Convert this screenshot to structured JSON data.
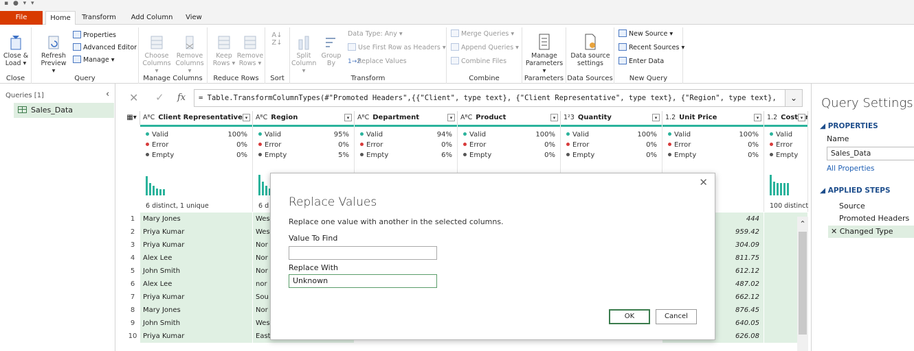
{
  "tabs": {
    "file": "File",
    "items": [
      "Home",
      "Transform",
      "Add Column",
      "View"
    ],
    "active": "Home"
  },
  "ribbon": {
    "close_group": "Close",
    "close_load": "Close &",
    "close_load2": "Load ▾",
    "query_group": "Query",
    "refresh": "Refresh",
    "refresh2": "Preview ▾",
    "properties": "Properties",
    "advanced_editor": "Advanced Editor",
    "manage": "Manage ▾",
    "manage_columns_group": "Manage Columns",
    "choose_columns": "Choose",
    "choose_columns2": "Columns ▾",
    "remove_columns": "Remove",
    "remove_columns2": "Columns ▾",
    "reduce_rows_group": "Reduce Rows",
    "keep_rows": "Keep",
    "keep_rows2": "Rows ▾",
    "remove_rows": "Remove",
    "remove_rows2": "Rows ▾",
    "sort_group": "Sort",
    "transform_group": "Transform",
    "split_column": "Split",
    "split_column2": "Column ▾",
    "group_by": "Group",
    "group_by2": "By",
    "data_type": "Data Type: Any ▾",
    "use_first_row": "Use First Row as Headers ▾",
    "replace_values": "Replace Values",
    "combine_group": "Combine",
    "merge_queries": "Merge Queries ▾",
    "append_queries": "Append Queries ▾",
    "combine_files": "Combine Files",
    "parameters_group": "Parameters",
    "manage_parameters": "Manage",
    "manage_parameters2": "Parameters ▾",
    "data_sources_group": "Data Sources",
    "data_source_settings": "Data source",
    "data_source_settings2": "settings",
    "new_query_group": "New Query",
    "new_source": "New Source ▾",
    "recent_sources": "Recent Sources ▾",
    "enter_data": "Enter Data"
  },
  "queries": {
    "header": "Queries [1]",
    "items": [
      "Sales_Data"
    ]
  },
  "formula": "= Table.TransformColumnTypes(#\"Promoted Headers\",{{\"Client\", type text}, {\"Client Representative\", type text}, {\"Region\", type text},",
  "columns": [
    {
      "type": "AᴮC",
      "name": "Client Representative",
      "valid": "100%",
      "error": "0%",
      "empty": "0%",
      "distinct": "6 distinct, 1 unique"
    },
    {
      "type": "AᴮC",
      "name": "Region",
      "valid": "95%",
      "error": "0%",
      "empty": "5%",
      "distinct": "6 d"
    },
    {
      "type": "AᴮC",
      "name": "Department",
      "valid": "94%",
      "error": "0%",
      "empty": "6%",
      "distinct": ""
    },
    {
      "type": "AᴮC",
      "name": "Product",
      "valid": "100%",
      "error": "0%",
      "empty": "0%",
      "distinct": ""
    },
    {
      "type": "1²3",
      "name": "Quantity",
      "valid": "100%",
      "error": "0%",
      "empty": "0%",
      "distinct": ""
    },
    {
      "type": "1.2",
      "name": "Unit Price",
      "valid": "100%",
      "error": "0%",
      "empty": "0%",
      "distinct": "unique"
    },
    {
      "type": "1.2",
      "name": "Cost Pric",
      "valid": "Valid",
      "error": "Error",
      "empty": "Empty",
      "distinct": "100 distinct,"
    }
  ],
  "profile_labels": {
    "valid": "Valid",
    "error": "Error",
    "empty": "Empty"
  },
  "rows": [
    {
      "n": "1",
      "rep": "Mary Jones",
      "region": "Wes",
      "price": "444"
    },
    {
      "n": "2",
      "rep": "Priya Kumar",
      "region": "Wes",
      "price": "959.42"
    },
    {
      "n": "3",
      "rep": "Priya Kumar",
      "region": "Nor",
      "price": "304.09"
    },
    {
      "n": "4",
      "rep": "Alex Lee",
      "region": "Nor",
      "price": "811.75"
    },
    {
      "n": "5",
      "rep": "John Smith",
      "region": "Nor",
      "price": "612.12"
    },
    {
      "n": "6",
      "rep": "Alex Lee",
      "region": "nor",
      "price": "487.02"
    },
    {
      "n": "7",
      "rep": "Priya Kumar",
      "region": "Sou",
      "price": "662.12"
    },
    {
      "n": "8",
      "rep": "Mary Jones",
      "region": "Nor",
      "price": "876.45"
    },
    {
      "n": "9",
      "rep": "John Smith",
      "region": "Wes",
      "price": "640.05"
    },
    {
      "n": "10",
      "rep": "Priya Kumar",
      "region": "East",
      "price": "626.08"
    }
  ],
  "settings": {
    "title": "Query Settings",
    "properties": "PROPERTIES",
    "name_label": "Name",
    "name_value": "Sales_Data",
    "all_properties": "All Properties",
    "applied_steps": "APPLIED STEPS",
    "steps": [
      "Source",
      "Promoted Headers",
      "Changed Type"
    ]
  },
  "dialog": {
    "title": "Replace Values",
    "desc": "Replace one value with another in the selected columns.",
    "find_label": "Value To Find",
    "find_value": "",
    "replace_label": "Replace With",
    "replace_value": "Unknown",
    "ok": "OK",
    "cancel": "Cancel"
  }
}
